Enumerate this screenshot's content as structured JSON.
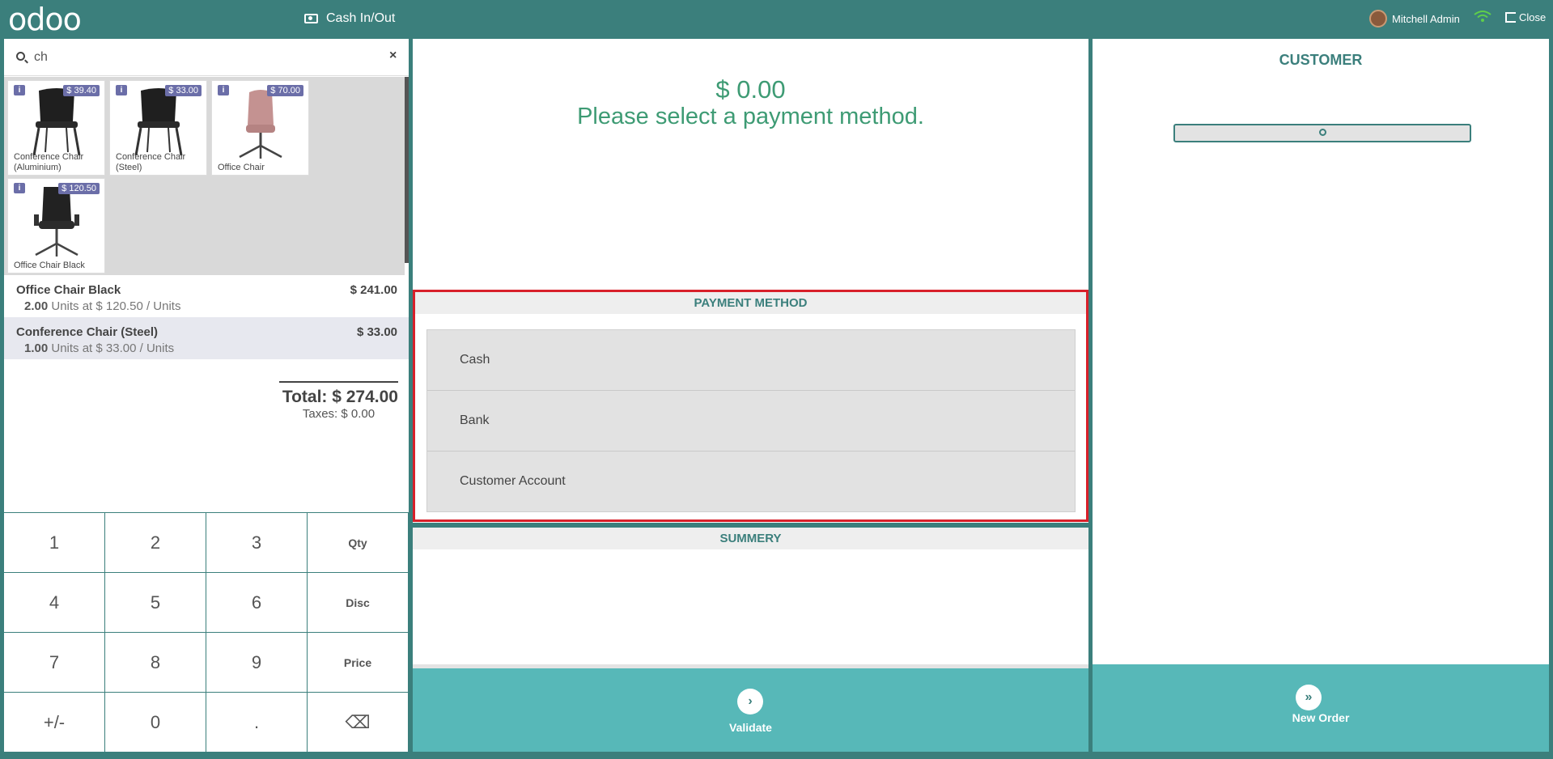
{
  "topbar": {
    "logo": "odoo",
    "cash_in_out": "Cash In/Out",
    "user_name": "Mitchell Admin",
    "close_label": "Close"
  },
  "search": {
    "value": "ch",
    "clear": "×"
  },
  "products": [
    {
      "name": "Conference Chair (Aluminium)",
      "price": "$ 39.40",
      "image": "black-stacking-chair"
    },
    {
      "name": "Conference Chair (Steel)",
      "price": "$ 33.00",
      "image": "black-stacking-chair"
    },
    {
      "name": "Office Chair",
      "price": "$ 70.00",
      "image": "pink-swivel-chair"
    },
    {
      "name": "Office Chair Black",
      "price": "$ 120.50",
      "image": "black-executive-chair"
    }
  ],
  "order_lines": [
    {
      "name": "Office Chair Black",
      "price": "$ 241.00",
      "qty": "2.00",
      "detail": "Units at $ 120.50 / Units"
    },
    {
      "name": "Conference Chair (Steel)",
      "price": "$ 33.00",
      "qty": "1.00",
      "detail": "Units at $ 33.00 / Units"
    }
  ],
  "totals": {
    "total": "Total: $ 274.00",
    "taxes": "Taxes: $ 0.00"
  },
  "numpad": [
    "1",
    "2",
    "3",
    "Qty",
    "4",
    "5",
    "6",
    "Disc",
    "7",
    "8",
    "9",
    "Price",
    "+/-",
    "0",
    ".",
    "⌫"
  ],
  "payment": {
    "amount": "$ 0.00",
    "prompt": "Please select a payment method.",
    "method_header": "PAYMENT METHOD",
    "methods": [
      "Cash",
      "Bank",
      "Customer Account"
    ],
    "summary_header": "SUMMERY",
    "validate": "Validate"
  },
  "customer": {
    "title": "CUSTOMER",
    "new_order": "New Order"
  },
  "colors": {
    "brand": "#3b7f7c",
    "accent": "#57b8b8",
    "amount_green": "#3e9b74",
    "highlight_red": "#d8202a"
  }
}
